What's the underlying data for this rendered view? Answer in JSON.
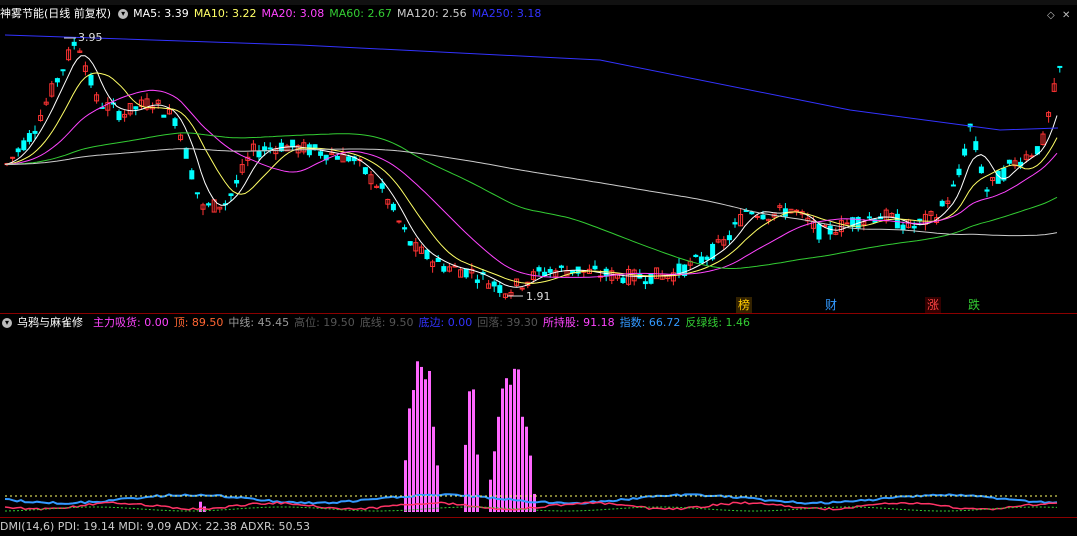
{
  "top_menu": {
    "items": [
      "",
      "",
      "",
      "",
      "",
      "",
      "",
      "",
      "",
      "",
      "",
      "",
      "",
      "",
      "",
      "",
      "",
      "",
      "",
      ""
    ]
  },
  "main_chart": {
    "title": "神雾节能",
    "period_label": "(日线 前复权)",
    "ma": [
      {
        "label": "MA5: 3.39",
        "color": "#ffffff"
      },
      {
        "label": "MA10: 3.22",
        "color": "#ffff66"
      },
      {
        "label": "MA20: 3.08",
        "color": "#ff44ff"
      },
      {
        "label": "MA60: 2.67",
        "color": "#33cc33"
      },
      {
        "label": "MA120: 2.56",
        "color": "#cccccc"
      },
      {
        "label": "MA250: 3.18",
        "color": "#3333ff"
      }
    ],
    "high_label": "3.95",
    "low_label": "1.91",
    "tags": [
      {
        "text": "榜",
        "color": "#ffcc00"
      },
      {
        "text": "财",
        "color": "#3399ff"
      },
      {
        "text": "涨",
        "color": "#ff4444"
      },
      {
        "text": "跌",
        "color": "#33cc33"
      }
    ]
  },
  "sub_chart": {
    "title": "乌鸦与麻雀修",
    "items": [
      {
        "label": "主力吸货: 0.00",
        "color": "#ff44ff"
      },
      {
        "label": "顶: 89.50",
        "color": "#ff6633"
      },
      {
        "label": "中线: 45.45",
        "color": "#999999"
      },
      {
        "label": "高位: 19.50",
        "color": "#555555"
      },
      {
        "label": "底线: 9.50",
        "color": "#555555"
      },
      {
        "label": "底边: 0.00",
        "color": "#3333ff"
      },
      {
        "label": "回落: 39.30",
        "color": "#555555"
      },
      {
        "label": "所持股: 91.18",
        "color": "#ff44ff"
      },
      {
        "label": "指数: 66.72",
        "color": "#3399ff"
      },
      {
        "label": "反绿线: 1.46",
        "color": "#33cc33"
      }
    ]
  },
  "bottom_indicator": {
    "label": "DMI(14,6) PDI: 19.14 MDI: 9.09 ADX: 22.38 ADXR: 50.53"
  },
  "colors": {
    "up": "#ff3333",
    "down": "#00ffff",
    "divider": "#8b0000"
  }
}
